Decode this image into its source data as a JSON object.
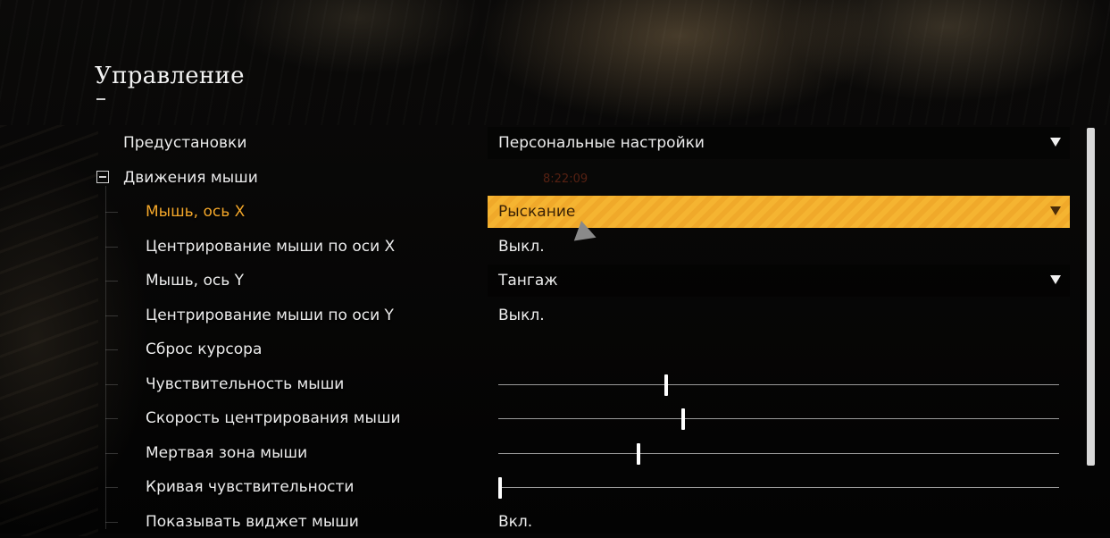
{
  "page": {
    "title": "Управление"
  },
  "overlay_time": "8:22:09",
  "rows": [
    {
      "label": "Предустановки",
      "control": "dropdown",
      "value": "Персональные настройки"
    },
    {
      "label": "Движения мыши",
      "control": "group"
    },
    {
      "label": "Мышь, ось X",
      "control": "dropdown",
      "value": "Рыскание",
      "active": true
    },
    {
      "label": "Центрирование мыши по оси X",
      "control": "toggle",
      "value": "Выкл."
    },
    {
      "label": "Мышь, ось Y",
      "control": "dropdown",
      "value": "Тангаж"
    },
    {
      "label": "Центрирование мыши по оси Y",
      "control": "toggle",
      "value": "Выкл."
    },
    {
      "label": "Сброс курсора",
      "control": "none"
    },
    {
      "label": "Чувствительность мыши",
      "control": "slider",
      "level": 0.3
    },
    {
      "label": "Скорость центрирования мыши",
      "control": "slider",
      "level": 0.33
    },
    {
      "label": "Мертвая зона мыши",
      "control": "slider",
      "level": 0.25
    },
    {
      "label": "Кривая чувствительности",
      "control": "slider",
      "level": 0.0
    },
    {
      "label": "Показывать виджет мыши",
      "control": "toggle",
      "value": "Вкл."
    }
  ],
  "colors": {
    "accent": "#f5b431",
    "active_label": "#f4a72a",
    "text": "#ececec"
  },
  "icons": {
    "dropdown": "triangle-down-icon",
    "group": "collapse-minus-icon",
    "cursor": "mouse-pointer-icon"
  }
}
